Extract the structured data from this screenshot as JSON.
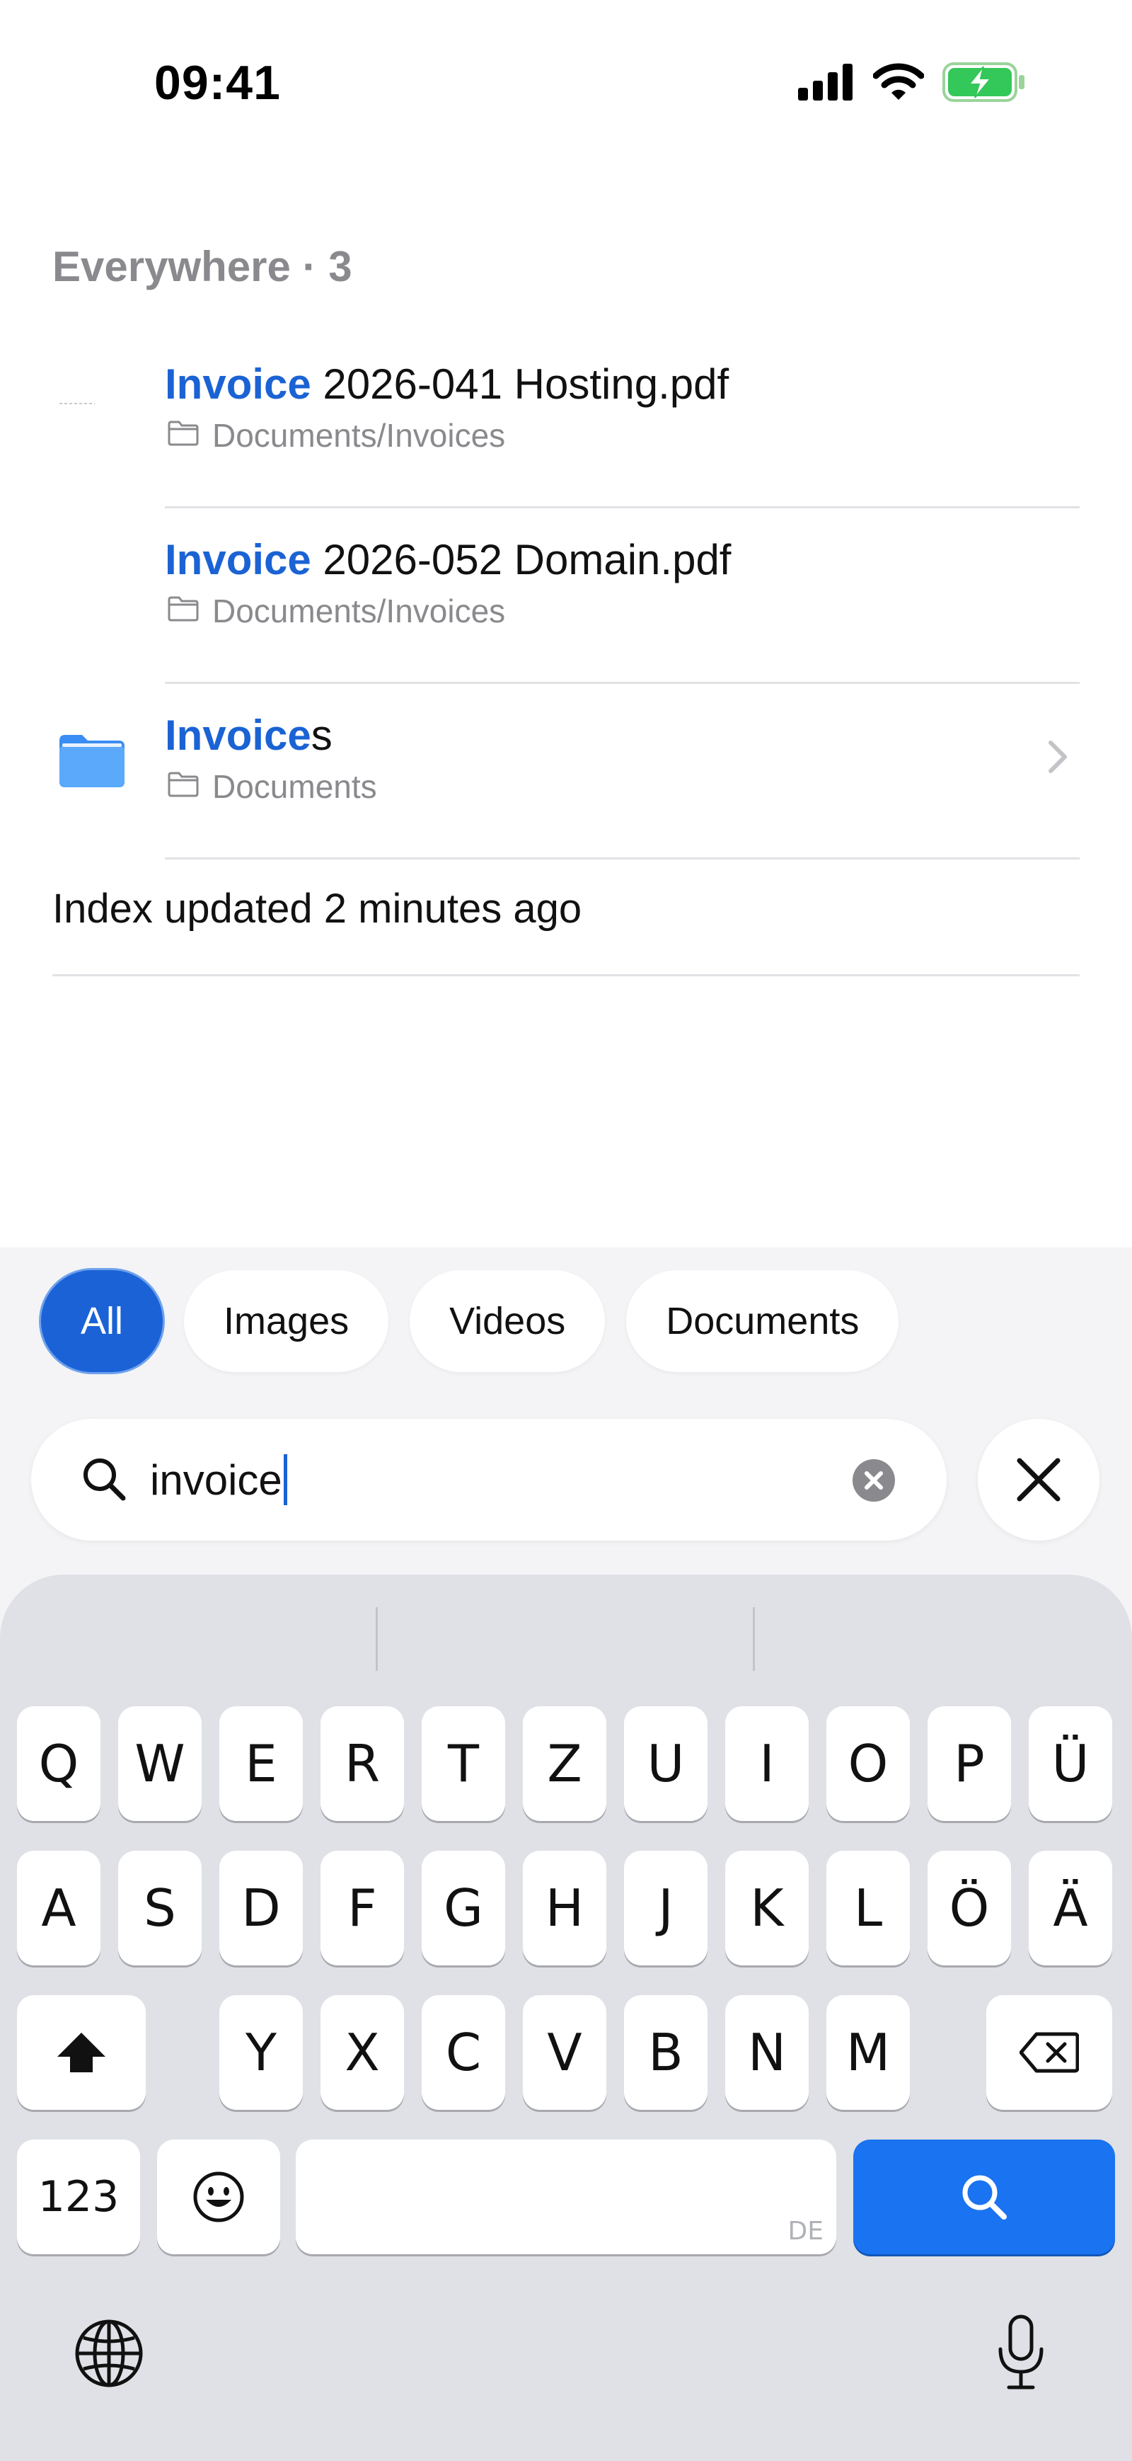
{
  "status_bar": {
    "time": "09:41",
    "icons": [
      "cellular-signal-icon",
      "wifi-icon",
      "battery-charging-icon"
    ]
  },
  "results": {
    "section_header": "Everywhere · 3",
    "items": [
      {
        "highlight": "Invoice",
        "rest": " 2026-041 Hosting.pdf",
        "path": "Documents/Invoices",
        "kind": "pdf"
      },
      {
        "highlight": "Invoice",
        "rest": " 2026-052 Domain.pdf",
        "path": "Documents/Invoices",
        "kind": "pdf"
      },
      {
        "highlight": "Invoice",
        "rest": "s",
        "path": "Documents",
        "kind": "folder"
      }
    ],
    "index_note": "Index updated 2 minutes ago"
  },
  "filters": {
    "items": [
      "All",
      "Images",
      "Videos",
      "Documents"
    ],
    "selected": "All"
  },
  "search": {
    "query": "invoice"
  },
  "keyboard": {
    "row1": [
      "Q",
      "W",
      "E",
      "R",
      "T",
      "Z",
      "U",
      "I",
      "O",
      "P",
      "Ü"
    ],
    "row2": [
      "A",
      "S",
      "D",
      "F",
      "G",
      "H",
      "J",
      "K",
      "L",
      "Ö",
      "Ä"
    ],
    "row3": [
      "Y",
      "X",
      "C",
      "V",
      "B",
      "N",
      "M"
    ],
    "numbers_label": "123",
    "space_language": "DE"
  },
  "colors": {
    "accent": "#1a62d6",
    "search_key": "#1a73f0",
    "folder": "#4a9df8",
    "secondary_text": "#8a8a8e"
  }
}
